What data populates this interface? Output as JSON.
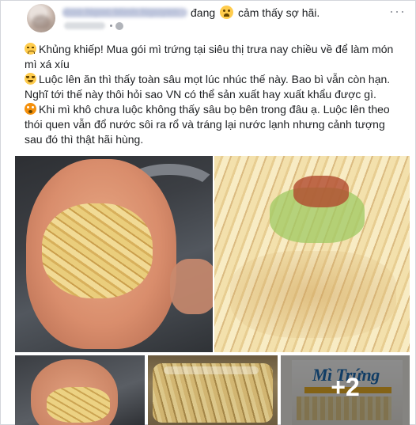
{
  "post": {
    "author": "Boo Ngoc Minh Nguyen",
    "feeling_prefix": "đang",
    "feeling_text": "cảm thấy sợ hãi.",
    "timestamp": "12 giờ",
    "more_label": "···",
    "lines": [
      "Khủng khiếp! Mua gói mì trứng tại siêu thị trưa nay chiều về để làm món mì xá xíu",
      "Luộc lên ăn thì thấy toàn sâu mọt lúc nhúc thế này. Bao bì vẫn còn hạn. Nghĩ tới thế này thôi hỏi sao VN có thể sản xuất hay xuất khẩu được gì.",
      "Khi mì khô chưa luộc không thấy sâu bọ bên trong đâu ạ. Luộc lên theo thói quen vẫn đổ nước sôi ra rổ và tráng lại nước lạnh nhưng cảnh tượng sau đó thì thật hãi hùng."
    ],
    "emojis": [
      "sad-face-icon",
      "crying-face-icon",
      "fearful-face-icon"
    ]
  },
  "photos": {
    "package_brand": "Mì Trứng",
    "more_count": "+2"
  },
  "colors": {
    "name_link": "#365899",
    "text": "#1c1e21",
    "meta": "#90949c"
  }
}
